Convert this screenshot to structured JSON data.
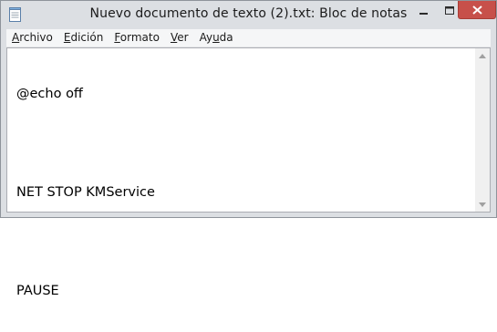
{
  "window": {
    "title": "Nuevo documento de texto (2).txt: Bloc de notas"
  },
  "menu": {
    "items": [
      {
        "prefix": "",
        "accel": "A",
        "rest": "rchivo"
      },
      {
        "prefix": "",
        "accel": "E",
        "rest": "dición"
      },
      {
        "prefix": "",
        "accel": "F",
        "rest": "ormato"
      },
      {
        "prefix": "",
        "accel": "V",
        "rest": "er"
      },
      {
        "prefix": "Ay",
        "accel": "u",
        "rest": "da"
      }
    ]
  },
  "document": {
    "lines": [
      "@echo off",
      "",
      "NET STOP KMService",
      "",
      "PAUSE"
    ]
  },
  "icons": {
    "app": "notepad-icon",
    "minimize": "minimize-icon",
    "maximize": "maximize-icon",
    "close": "close-icon",
    "scroll_up": "scroll-up-arrow-icon",
    "scroll_down": "scroll-down-arrow-icon"
  },
  "colors": {
    "close_button": "#c7504a",
    "frame": "#dcdfe3"
  }
}
